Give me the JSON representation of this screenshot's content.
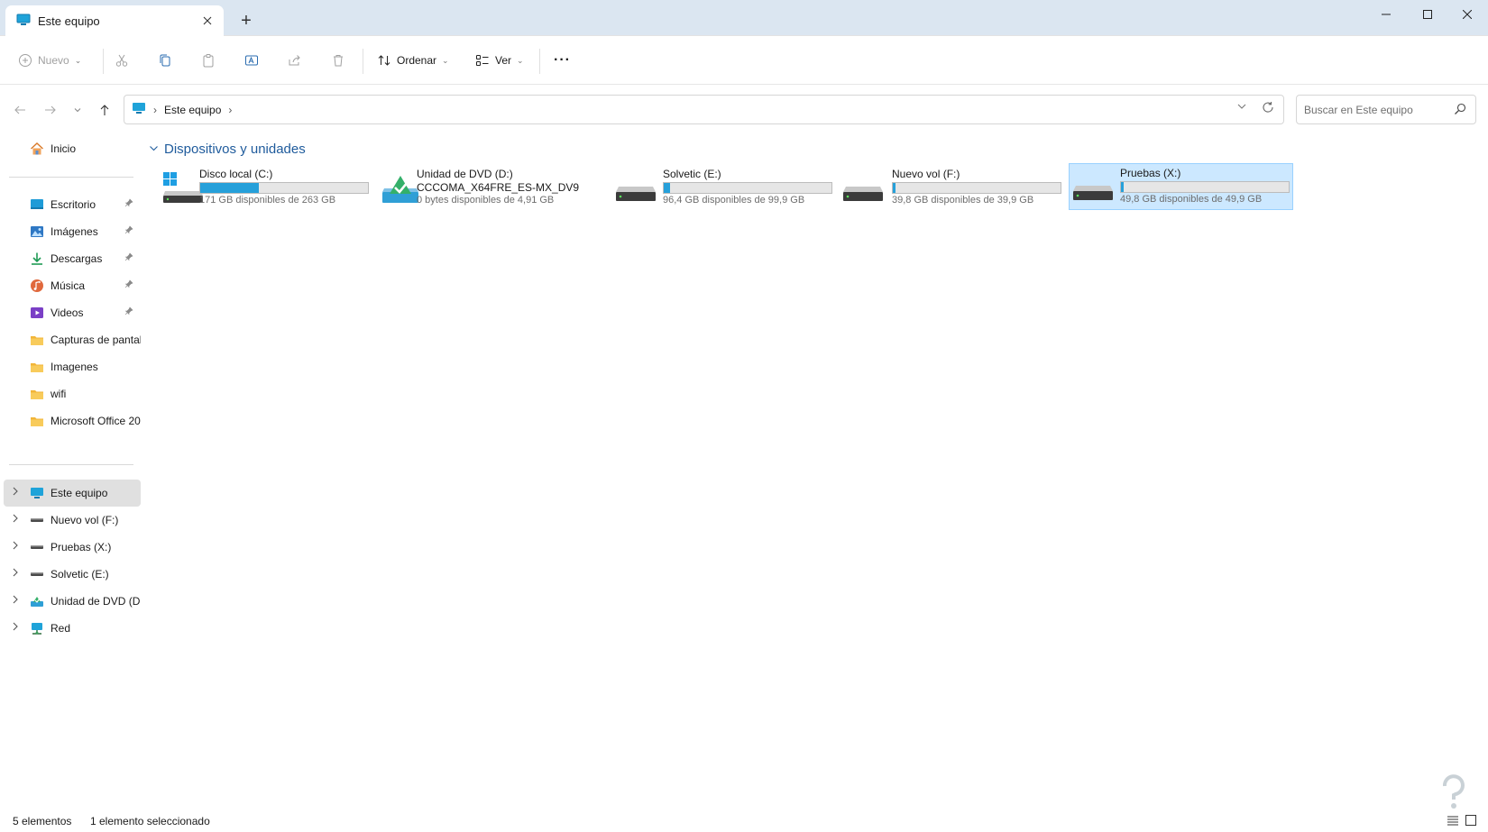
{
  "window": {
    "tab_title": "Este equipo",
    "new_tab_symbol": "+"
  },
  "toolbar": {
    "new_label": "Nuevo",
    "sort_label": "Ordenar",
    "view_label": "Ver",
    "more_label": "···"
  },
  "address": {
    "crumbs": [
      "Este equipo"
    ],
    "search_placeholder": "Buscar en Este equipo"
  },
  "sidebar": {
    "home": "Inicio",
    "quick_access": [
      {
        "label": "Escritorio",
        "icon": "desktop-icon",
        "pinned": true
      },
      {
        "label": "Imágenes",
        "icon": "pictures-icon",
        "pinned": true
      },
      {
        "label": "Descargas",
        "icon": "downloads-icon",
        "pinned": true
      },
      {
        "label": "Música",
        "icon": "music-icon",
        "pinned": true
      },
      {
        "label": "Videos",
        "icon": "videos-icon",
        "pinned": true
      },
      {
        "label": "Capturas de pantall",
        "icon": "folder-icon",
        "pinned": false
      },
      {
        "label": "Imagenes",
        "icon": "folder-icon",
        "pinned": false
      },
      {
        "label": "wifi",
        "icon": "folder-icon",
        "pinned": false
      },
      {
        "label": "Microsoft Office 20",
        "icon": "folder-icon",
        "pinned": false
      }
    ],
    "tree": [
      {
        "label": "Este equipo",
        "icon": "pc-icon"
      },
      {
        "label": "Nuevo vol (F:)",
        "icon": "drive-icon"
      },
      {
        "label": "Pruebas (X:)",
        "icon": "drive-icon"
      },
      {
        "label": "Solvetic (E:)",
        "icon": "drive-icon"
      },
      {
        "label": "Unidad de DVD (D:)",
        "icon": "dvd-icon"
      },
      {
        "label": "Red",
        "icon": "network-icon"
      }
    ]
  },
  "main": {
    "section_title": "Dispositivos y unidades",
    "drives": [
      {
        "name": "Disco local (C:)",
        "free_text": "171 GB disponibles de 263 GB",
        "used_fraction": 0.35,
        "icon": "windows-drive-icon"
      },
      {
        "name": "Unidad de DVD (D:)",
        "name_line2": "CCCOMA_X64FRE_ES-MX_DV9",
        "free_text": "0 bytes disponibles de 4,91 GB",
        "icon": "dvd-drive-icon"
      },
      {
        "name": "Solvetic (E:)",
        "free_text": "96,4 GB disponibles de 99,9 GB",
        "used_fraction": 0.035,
        "icon": "hdd-icon"
      },
      {
        "name": "Nuevo vol (F:)",
        "free_text": "39,8 GB disponibles de 39,9 GB",
        "used_fraction": 0.003,
        "icon": "hdd-icon"
      },
      {
        "name": "Pruebas (X:)",
        "free_text": "49,8 GB disponibles de 49,9 GB",
        "used_fraction": 0.002,
        "icon": "hdd-icon",
        "selected": true
      }
    ]
  },
  "status": {
    "count": "5 elementos",
    "selected": "1 elemento seleccionado"
  },
  "colors": {
    "accent": "#26a0da",
    "selection": "#cce8ff",
    "section_title": "#1f5b9c"
  }
}
